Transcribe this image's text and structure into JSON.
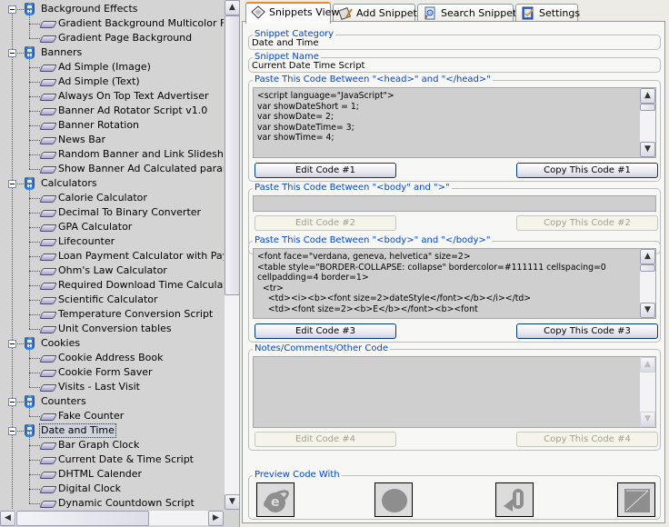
{
  "tree": {
    "items": [
      {
        "type": "category",
        "label": "Background Effects"
      },
      {
        "type": "leaf",
        "label": "Gradient Background Multicolor Fader"
      },
      {
        "type": "leaf",
        "label": "Gradient Page  Background"
      },
      {
        "type": "category",
        "label": "Banners"
      },
      {
        "type": "leaf",
        "label": "Ad Simple (Image)"
      },
      {
        "type": "leaf",
        "label": "Ad Simple (Text)"
      },
      {
        "type": "leaf",
        "label": "Always On Top Text Advertiser"
      },
      {
        "type": "leaf",
        "label": "Banner Ad Rotator Script v1.0"
      },
      {
        "type": "leaf",
        "label": "Banner Rotation"
      },
      {
        "type": "leaf",
        "label": "News Bar"
      },
      {
        "type": "leaf",
        "label": "Random Banner and Link Slideshow"
      },
      {
        "type": "leaf",
        "label": "Show Banner Ad Calculated paramter"
      },
      {
        "type": "category",
        "label": "Calculators"
      },
      {
        "type": "leaf",
        "label": "Calorie Calculator"
      },
      {
        "type": "leaf",
        "label": "Decimal To Binary Converter"
      },
      {
        "type": "leaf",
        "label": "GPA Calculator"
      },
      {
        "type": "leaf",
        "label": "Lifecounter"
      },
      {
        "type": "leaf",
        "label": "Loan Payment Calculator with Payment"
      },
      {
        "type": "leaf",
        "label": "Ohm's Law Calculator"
      },
      {
        "type": "leaf",
        "label": "Required Download Time Calculator"
      },
      {
        "type": "leaf",
        "label": "Scientific Calculator"
      },
      {
        "type": "leaf",
        "label": "Temperature Conversion Script"
      },
      {
        "type": "leaf",
        "label": "Unit Conversion tables"
      },
      {
        "type": "category",
        "label": "Cookies"
      },
      {
        "type": "leaf",
        "label": "Cookie Address Book"
      },
      {
        "type": "leaf",
        "label": "Cookie Form Saver"
      },
      {
        "type": "leaf",
        "label": "Visits - Last Visit"
      },
      {
        "type": "category",
        "label": "Counters"
      },
      {
        "type": "leaf",
        "label": "Fake Counter"
      },
      {
        "type": "category",
        "label": "Date and Time",
        "selected": true
      },
      {
        "type": "leaf",
        "label": "Bar Graph Clock"
      },
      {
        "type": "leaf",
        "label": "Current Date & Time Script"
      },
      {
        "type": "leaf",
        "label": "DHTML Calender"
      },
      {
        "type": "leaf",
        "label": "Digital Clock"
      },
      {
        "type": "leaf",
        "label": "Dynamic Countdown Script"
      }
    ]
  },
  "tabs": [
    {
      "label": "Snippets View",
      "icon": "snippets-view-icon",
      "active": true
    },
    {
      "label": "Add Snippets",
      "icon": "add-snippets-icon"
    },
    {
      "label": "Search Snippets",
      "icon": "search-snippets-icon"
    },
    {
      "label": "Settings",
      "icon": "settings-icon"
    }
  ],
  "snippet": {
    "category_label": "Snippet Category",
    "category_value": "Date and Time",
    "name_label": "Snippet Name",
    "name_value": "Current Date  Time Script"
  },
  "code_sections": [
    {
      "title": "Paste This Code Between \"<head>\" and \"</head>\"",
      "code": "<script language=\"JavaScript\">\nvar showDateShort = 1;\nvar showDate= 2;\nvar showDateTime= 3;\nvar showTime= 4;",
      "edit_label": "Edit Code #1",
      "copy_label": "Copy This Code #1",
      "enabled": true
    },
    {
      "title": "Paste This Code Between \"<body\" and \">\"",
      "code": "",
      "edit_label": "Edit Code #2",
      "copy_label": "Copy This Code #2",
      "enabled": false
    },
    {
      "title": "Paste This Code Between \"<body>\" and \"</body>\"",
      "code": "<font face=\"verdana, geneva, helvetica\" size=2>\n<table style=\"BORDER-COLLAPSE: collapse\" bordercolor=#111111 cellspacing=0\ncellpadding=4 border=1>\n  <tr>\n    <td><i><b><font size=2>dateStyle</font></b></i></td>\n    <td><font size=2><b>E</b></font><b><font",
      "edit_label": "Edit Code #3",
      "copy_label": "Copy This Code #3",
      "enabled": true
    },
    {
      "title": "Notes/Comments/Other Code",
      "code": "",
      "edit_label": "Edit Code #4",
      "copy_label": "Copy This Code #4",
      "enabled": false
    }
  ],
  "preview": {
    "title": "Preview Code With",
    "browsers": [
      {
        "name": "internet-explorer"
      },
      {
        "name": "opera"
      },
      {
        "name": "netscape"
      },
      {
        "name": "other-browser"
      }
    ]
  }
}
